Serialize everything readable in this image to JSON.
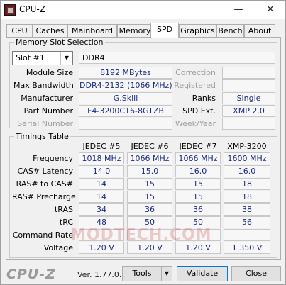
{
  "window": {
    "title": "CPU-Z",
    "minimize": "—",
    "close": "✕"
  },
  "tabs": [
    "CPU",
    "Caches",
    "Mainboard",
    "Memory",
    "SPD",
    "Graphics",
    "Bench",
    "About"
  ],
  "active_tab": "SPD",
  "memory_slot": {
    "legend": "Memory Slot Selection",
    "slot_selected": "Slot #1",
    "type": "DDR4",
    "labels": {
      "module_size": "Module Size",
      "max_bandwidth": "Max Bandwidth",
      "manufacturer": "Manufacturer",
      "part_number": "Part Number",
      "serial_number": "Serial Number",
      "correction": "Correction",
      "registered": "Registered",
      "ranks": "Ranks",
      "spd_ext": "SPD Ext.",
      "week_year": "Week/Year"
    },
    "values": {
      "module_size": "8192 MBytes",
      "max_bandwidth": "DDR4-2132 (1066 MHz)",
      "manufacturer": "G.Skill",
      "part_number": "F4-3200C16-8GTZB",
      "serial_number": "",
      "correction": "",
      "registered": "",
      "ranks": "Single",
      "spd_ext": "XMP 2.0",
      "week_year": ""
    }
  },
  "timings": {
    "legend": "Timings Table",
    "columns": [
      "JEDEC #5",
      "JEDEC #6",
      "JEDEC #7",
      "XMP-3200"
    ],
    "rows": [
      {
        "label": "Frequency",
        "values": [
          "1018 MHz",
          "1066 MHz",
          "1066 MHz",
          "1600 MHz"
        ]
      },
      {
        "label": "CAS# Latency",
        "values": [
          "14.0",
          "15.0",
          "16.0",
          "16.0"
        ]
      },
      {
        "label": "RAS# to CAS#",
        "values": [
          "14",
          "15",
          "15",
          "18"
        ]
      },
      {
        "label": "RAS# Precharge",
        "values": [
          "14",
          "15",
          "15",
          "18"
        ]
      },
      {
        "label": "tRAS",
        "values": [
          "34",
          "36",
          "36",
          "38"
        ]
      },
      {
        "label": "tRC",
        "values": [
          "48",
          "50",
          "50",
          "56"
        ]
      },
      {
        "label": "Command Rate",
        "values": [
          "",
          "",
          "",
          ""
        ]
      },
      {
        "label": "Voltage",
        "values": [
          "1.20 V",
          "1.20 V",
          "1.20 V",
          "1.350 V"
        ]
      }
    ]
  },
  "footer": {
    "brand": "CPU-Z",
    "version": "Ver. 1.77.0.x64",
    "tools": "Tools",
    "tools_arrow": "▼",
    "validate": "Validate",
    "close": "Close"
  },
  "watermark": "MODTECH.COM",
  "colors": {
    "value_text": "#1a2a80",
    "label_gray": "#a0a0a0",
    "accent": "#0078d7"
  }
}
